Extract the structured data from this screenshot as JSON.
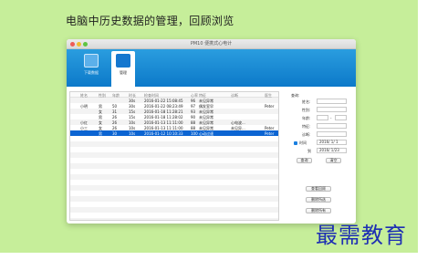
{
  "slide": {
    "heading": "电脑中历史数据的管理，回顾浏览"
  },
  "window": {
    "title": "PM10 便携式心电计",
    "nav": [
      {
        "label": "下载数据",
        "icon": "download-icon"
      },
      {
        "label": "管理",
        "icon": "manage-icon"
      }
    ]
  },
  "table": {
    "headers": [
      "姓名",
      "性别",
      "年龄",
      "时长",
      "检查时间",
      "心率",
      "特征",
      "诊断",
      "医生"
    ],
    "rows": [
      [
        "",
        "",
        "",
        "30s",
        "2016-01-22 15:08:45",
        "96",
        "未见异常",
        "",
        ""
      ],
      [
        "小明",
        "男",
        "50",
        "30s",
        "2016-01-22 08:23:49",
        "97",
        "偶发室早",
        "",
        "Peter"
      ],
      [
        "",
        "女",
        "31",
        "15s",
        "2016-01-18 11:28:21",
        "93",
        "未见异常",
        "",
        ""
      ],
      [
        "",
        "男",
        "26",
        "15s",
        "2016-01-18 11:28:02",
        "90",
        "未见异常",
        "",
        ""
      ],
      [
        "小红",
        "女",
        "26",
        "10s",
        "2016-01-13 11:11:00",
        "88",
        "未见异常",
        "心电波...",
        ""
      ],
      [
        "小三",
        "女",
        "26",
        "10s",
        "2016-01-13 11:11:00",
        "88",
        "未见异常",
        "未见异...",
        "Peter"
      ],
      [
        "",
        "男",
        "30",
        "10s",
        "2016-01-12 10:10:33",
        "100",
        "心动过速",
        "",
        "Peter"
      ]
    ],
    "selected_row": 6
  },
  "query": {
    "title": "查询:",
    "name_label": "姓名:",
    "gender_label": "性别:",
    "age_label": "年龄:",
    "age_separator": "-",
    "feature_label": "特征:",
    "diagnosis_label": "诊断:",
    "time_label": "时间",
    "time_from": "2016/ 1/ 1",
    "to_label": "到",
    "time_to": "2016/ 1/23",
    "search_button": "查询",
    "clear_button": "清空",
    "view_button": "查看回顾",
    "delete_selected_button": "删除所选",
    "delete_all_button": "删除所有",
    "time_checked": true
  },
  "watermark": "最需教育"
}
